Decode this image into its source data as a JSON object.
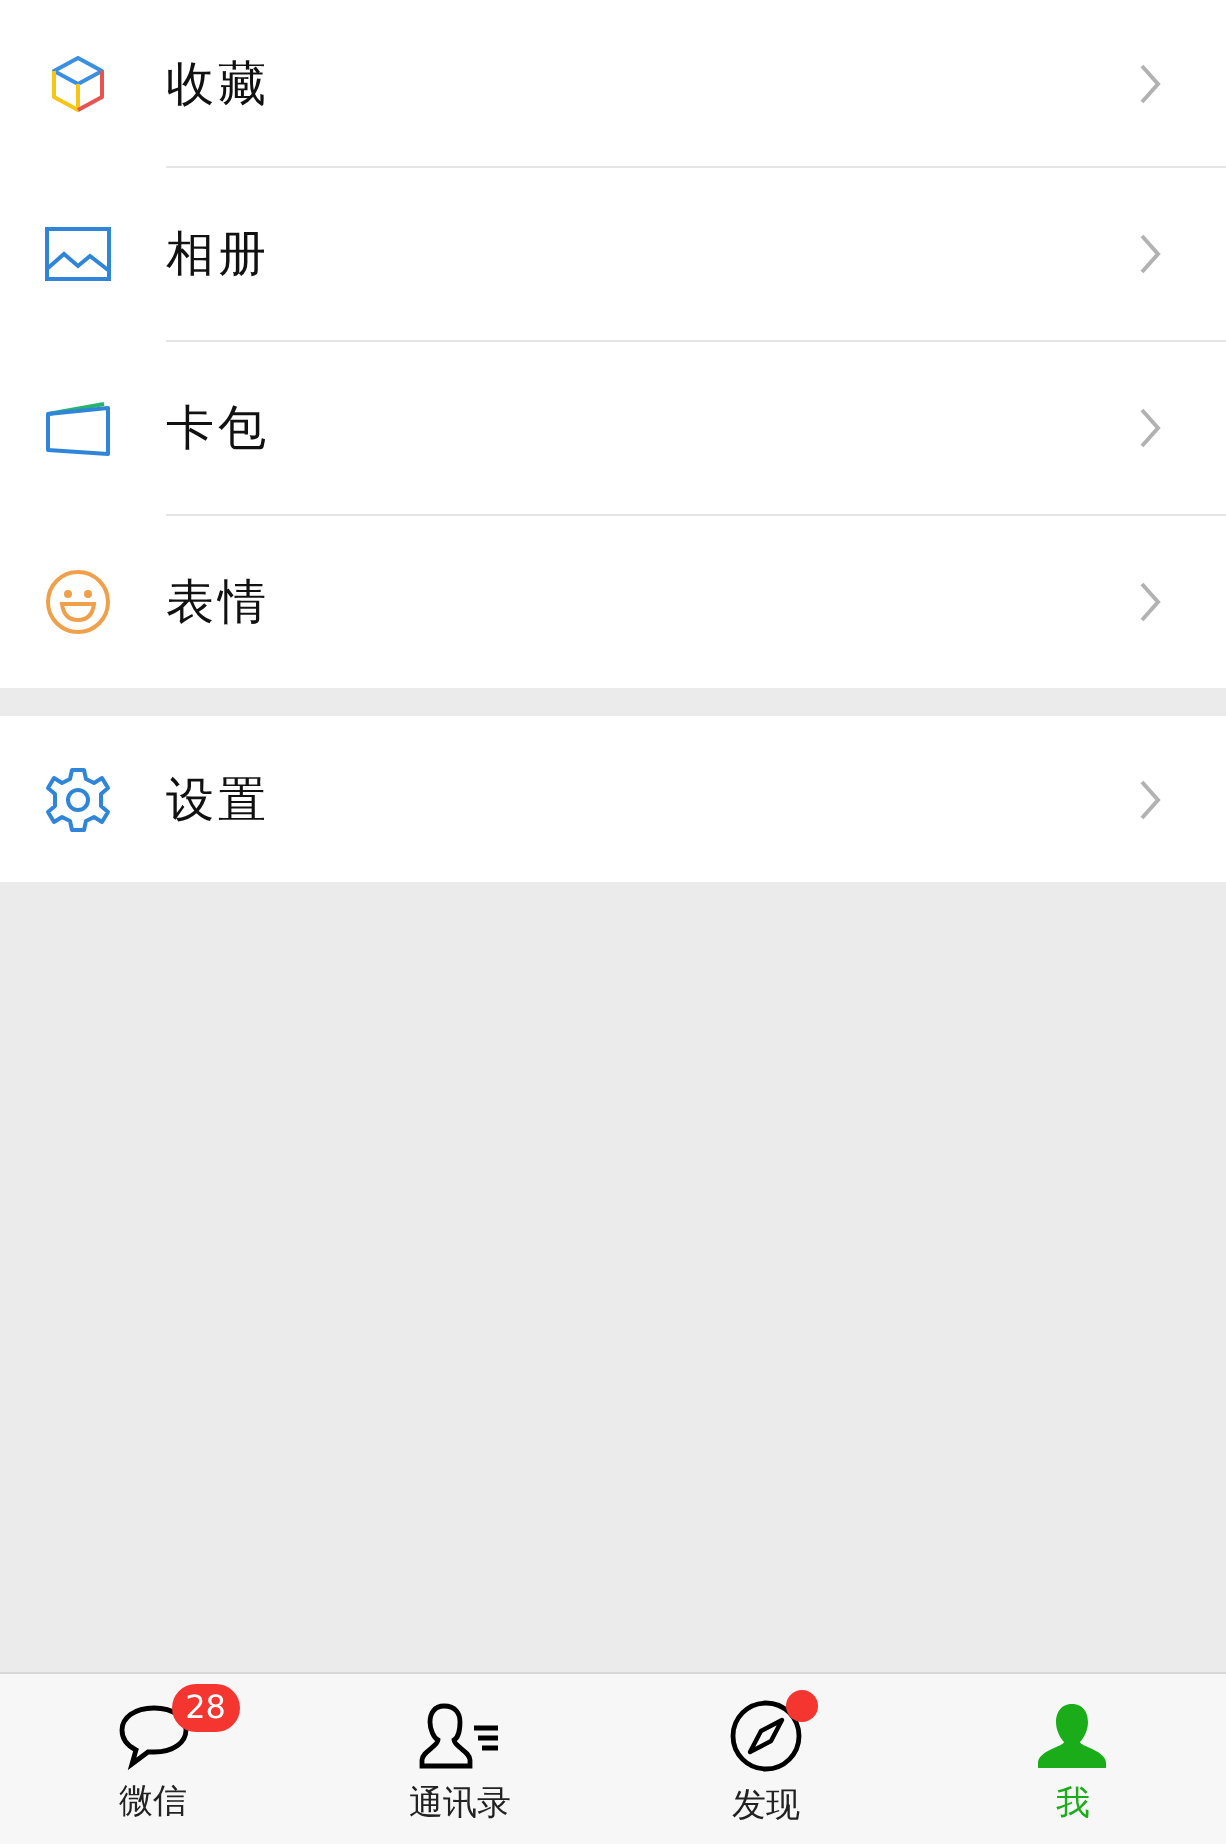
{
  "groups": [
    {
      "items": [
        {
          "kind": "favorites",
          "label": "收藏"
        },
        {
          "kind": "album",
          "label": "相册"
        },
        {
          "kind": "cards",
          "label": "卡包"
        },
        {
          "kind": "stickers",
          "label": "表情"
        }
      ]
    },
    {
      "items": [
        {
          "kind": "settings",
          "label": "设置"
        }
      ]
    }
  ],
  "tabs": [
    {
      "kind": "chats",
      "label": "微信",
      "selected": false,
      "badge": "28",
      "dot": false
    },
    {
      "kind": "contacts",
      "label": "通讯录",
      "selected": false,
      "dot": false
    },
    {
      "kind": "discover",
      "label": "发现",
      "selected": false,
      "dot": true
    },
    {
      "kind": "me",
      "label": "我",
      "selected": true,
      "dot": false
    }
  ]
}
